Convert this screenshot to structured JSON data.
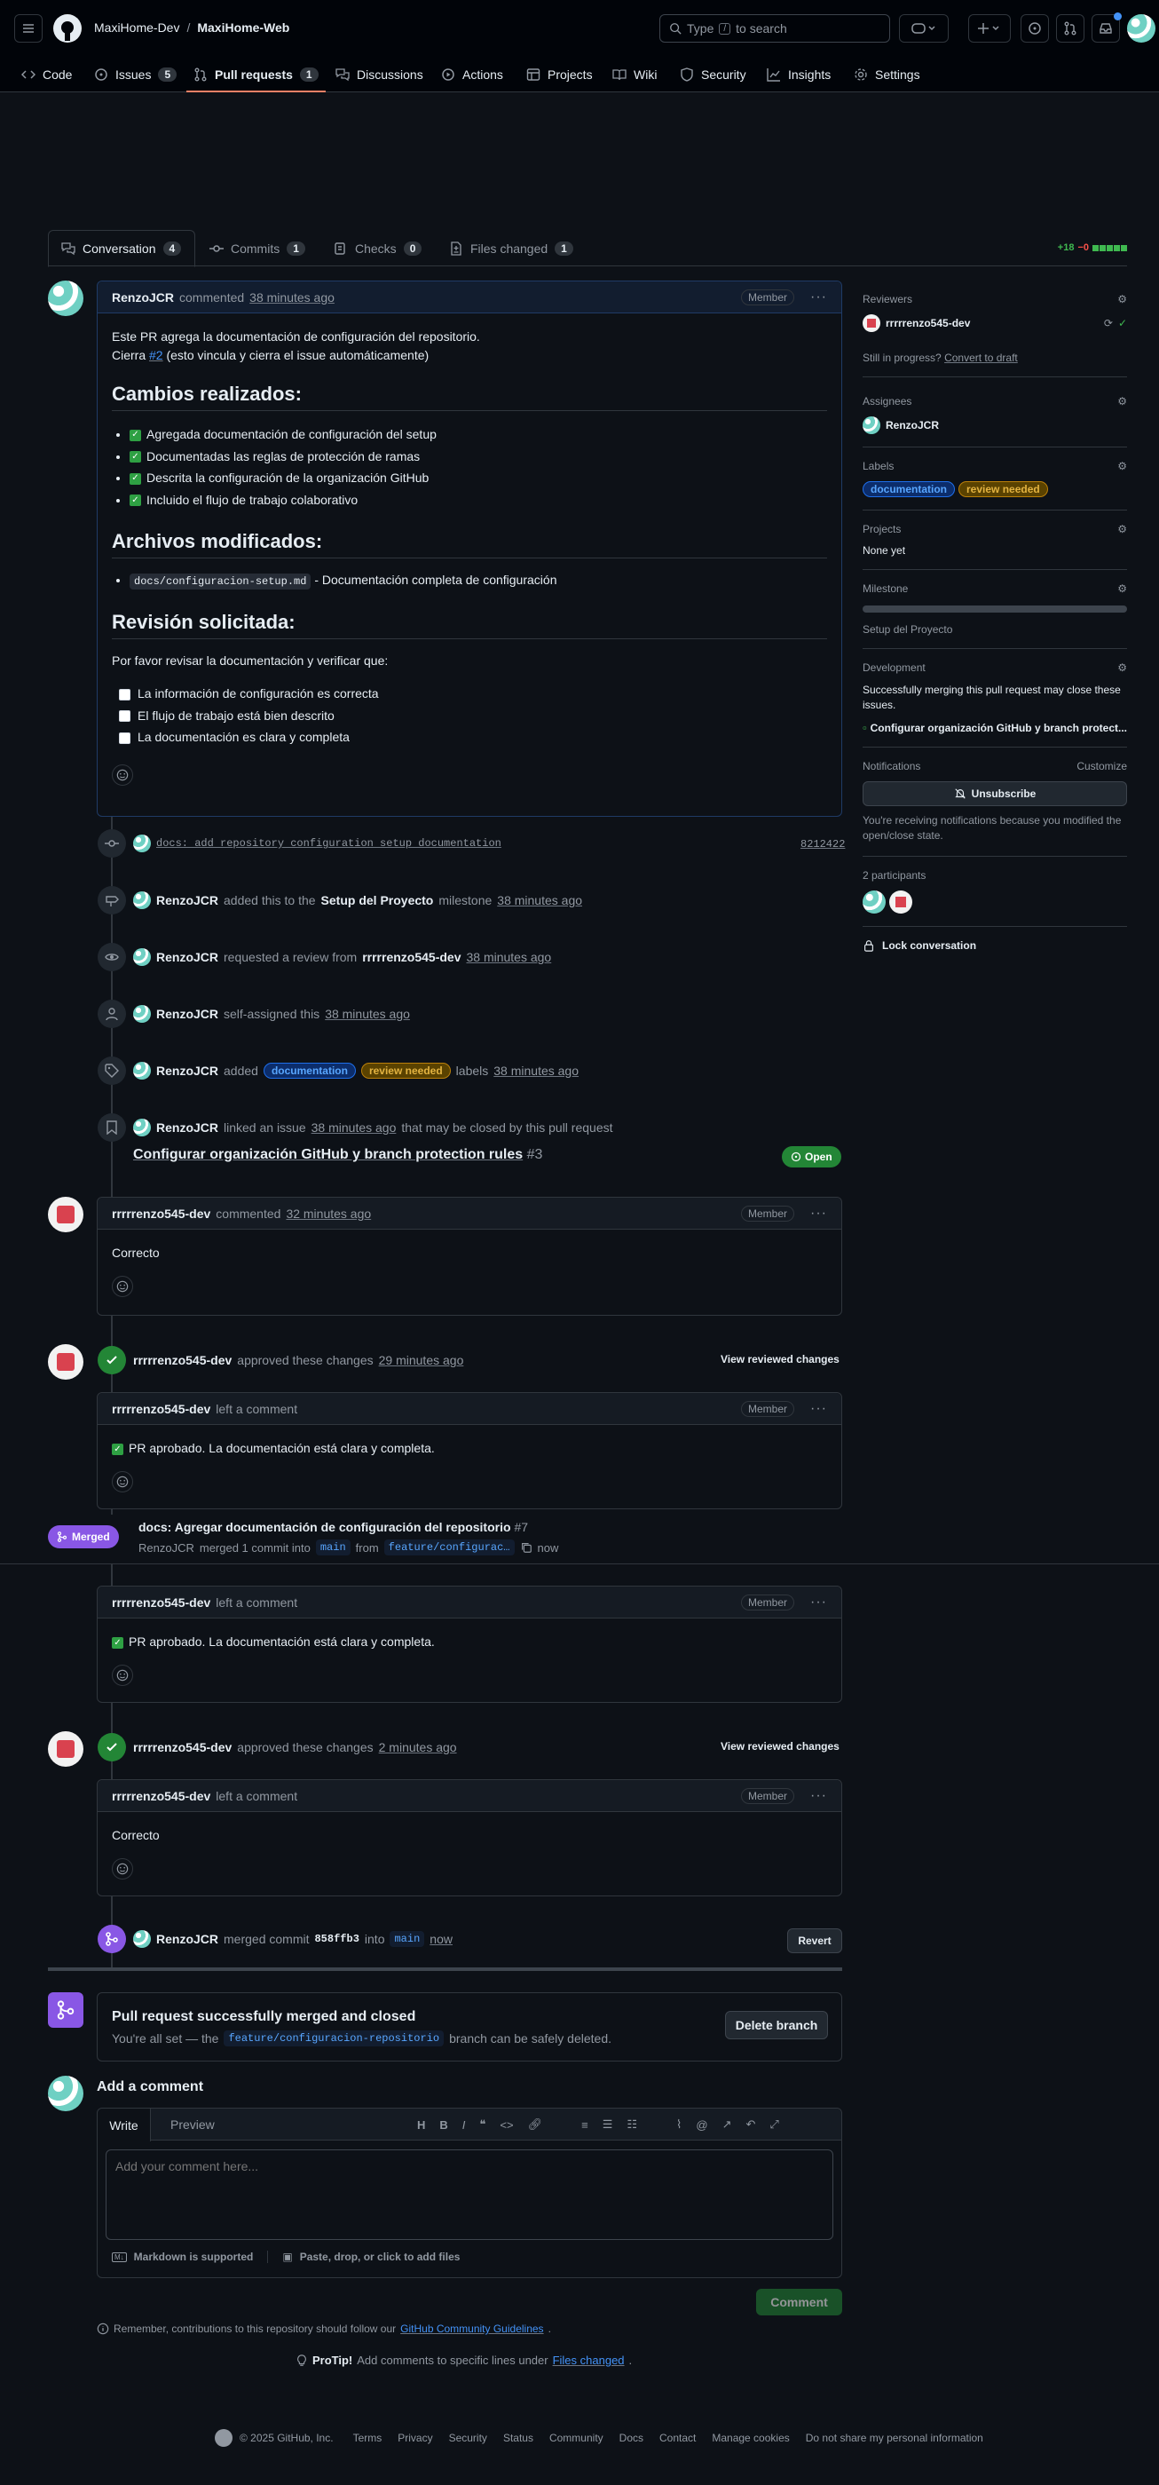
{
  "header": {
    "org": "MaxiHome-Dev",
    "separator": "/",
    "repo": "MaxiHome-Web",
    "search_prefix": "Type",
    "search_key": "/",
    "search_suffix": "to search"
  },
  "nav": {
    "code": "Code",
    "issues": "Issues",
    "issues_count": "5",
    "pulls": "Pull requests",
    "pulls_count": "1",
    "discussions": "Discussions",
    "actions": "Actions",
    "projects": "Projects",
    "wiki": "Wiki",
    "security": "Security",
    "insights": "Insights",
    "settings": "Settings"
  },
  "prtabs": {
    "conversation": "Conversation",
    "conversation_count": "4",
    "commits": "Commits",
    "commits_count": "1",
    "checks": "Checks",
    "checks_count": "0",
    "files": "Files changed",
    "files_count": "1",
    "additions": "+18",
    "deletions": "−0"
  },
  "first_comment": {
    "author": "RenzoJCR",
    "action": "commented",
    "time": "38 minutes ago",
    "role": "Member",
    "intro": "Este PR agrega la documentación de configuración del repositorio.",
    "closes_pre": "Cierra",
    "closes_ref": "#2",
    "closes_post": "(esto vincula y cierra el issue automáticamente)",
    "h_changes": "Cambios realizados:",
    "changes": [
      "Agregada documentación de configuración del setup",
      "Documentadas las reglas de protección de ramas",
      "Descrita la configuración de la organización GitHub",
      "Incluido el flujo de trabajo colaborativo"
    ],
    "h_files": "Archivos modificados:",
    "file_code": "docs/configuracion-setup.md",
    "file_desc": "- Documentación completa de configuración",
    "h_review": "Revisión solicitada:",
    "review_intro": "Por favor revisar la documentación y verificar que:",
    "review_items": [
      "La información de configuración es correcta",
      "El flujo de trabajo está bien descrito",
      "La documentación es clara y completa"
    ]
  },
  "events": {
    "commit_msg": "docs: add repository configuration setup documentation",
    "commit_sha": "8212422",
    "milestone_author": "RenzoJCR",
    "milestone_text": "added this to the",
    "milestone_name": "Setup del Proyecto",
    "milestone_suffix": "milestone",
    "milestone_time": "38 minutes ago",
    "review_author": "RenzoJCR",
    "review_text": "requested a review from",
    "review_user": "rrrrrenzo545-dev",
    "review_time": "38 minutes ago",
    "assign_author": "RenzoJCR",
    "assign_text": "self-assigned this",
    "assign_time": "38 minutes ago",
    "label_author": "RenzoJCR",
    "label_text": "added",
    "label_doc": "documentation",
    "label_rev": "review needed",
    "label_suffix": "labels",
    "label_time": "38 minutes ago",
    "link_author": "RenzoJCR",
    "link_text": "linked an issue",
    "link_time": "38 minutes ago",
    "link_suffix": "that may be closed by this pull request",
    "issue_title": "Configurar organización GitHub y branch protection rules",
    "issue_num": "#3",
    "issue_state": "Open"
  },
  "comment2": {
    "author": "rrrrrenzo545-dev",
    "action": "commented",
    "time": "32 minutes ago",
    "role": "Member",
    "body": "Correcto"
  },
  "review1": {
    "author": "rrrrrenzo545-dev",
    "action": "approved these changes",
    "time": "29 minutes ago",
    "view": "View reviewed changes",
    "c_author": "rrrrrenzo545-dev",
    "c_action": "left a comment",
    "role": "Member",
    "body": "PR aprobado. La documentación está clara y completa."
  },
  "sticky": {
    "state": "Merged",
    "title": "docs: Agregar documentación de configuración del repositorio",
    "num": "#7",
    "author": "RenzoJCR",
    "text": "merged 1 commit into",
    "base": "main",
    "from": "from",
    "head": "feature/configurac…",
    "time": "now"
  },
  "review1b": {
    "c_author": "rrrrrenzo545-dev",
    "c_action": "left a comment",
    "role": "Member",
    "body": "PR aprobado. La documentación está clara y completa."
  },
  "review2": {
    "author": "rrrrrenzo545-dev",
    "action": "approved these changes",
    "time": "2 minutes ago",
    "view": "View reviewed changes",
    "c_author": "rrrrrenzo545-dev",
    "c_action": "left a comment",
    "role": "Member",
    "body": "Correcto"
  },
  "merge": {
    "author": "RenzoJCR",
    "text": "merged commit",
    "sha": "858ffb3",
    "into": "into",
    "base": "main",
    "time": "now",
    "revert": "Revert"
  },
  "merged_box": {
    "title": "Pull request successfully merged and closed",
    "pre": "You're all set — the",
    "branch": "feature/configuracion-repositorio",
    "post": "branch can be safely deleted.",
    "delete": "Delete branch"
  },
  "add_comment": {
    "title": "Add a comment",
    "write": "Write",
    "preview": "Preview",
    "placeholder": "Add your comment here...",
    "markdown": "Markdown is supported",
    "attach": "Paste, drop, or click to add files",
    "submit": "Comment",
    "remember_pre": "Remember, contributions to this repository should follow our",
    "remember_link": "GitHub Community Guidelines",
    "remember_post": ".",
    "protip_b": "ProTip!",
    "protip_text": "Add comments to specific lines under",
    "protip_link": "Files changed",
    "protip_post": "."
  },
  "sidebar": {
    "reviewers": "Reviewers",
    "reviewer": "rrrrrenzo545-dev",
    "still": "Still in progress?",
    "convert": "Convert to draft",
    "assignees": "Assignees",
    "assignee": "RenzoJCR",
    "labels": "Labels",
    "label1": "documentation",
    "label2": "review needed",
    "projects": "Projects",
    "projects_val": "None yet",
    "milestone": "Milestone",
    "milestone_val": "Setup del Proyecto",
    "development": "Development",
    "dev_text": "Successfully merging this pull request may close these issues.",
    "dev_issue": "Configurar organización GitHub y branch protect...",
    "notifications": "Notifications",
    "customize": "Customize",
    "unsubscribe": "Unsubscribe",
    "notif_text": "You're receiving notifications because you modified the open/close state.",
    "participants": "2 participants",
    "lock": "Lock conversation"
  },
  "footer": {
    "copyright": "© 2025 GitHub, Inc.",
    "links": [
      "Terms",
      "Privacy",
      "Security",
      "Status",
      "Community",
      "Docs",
      "Contact",
      "Manage cookies",
      "Do not share my personal information"
    ]
  },
  "colors": {
    "accent": "#4493f8",
    "success": "#238636",
    "done": "#8957e5",
    "danger": "#f85149"
  }
}
